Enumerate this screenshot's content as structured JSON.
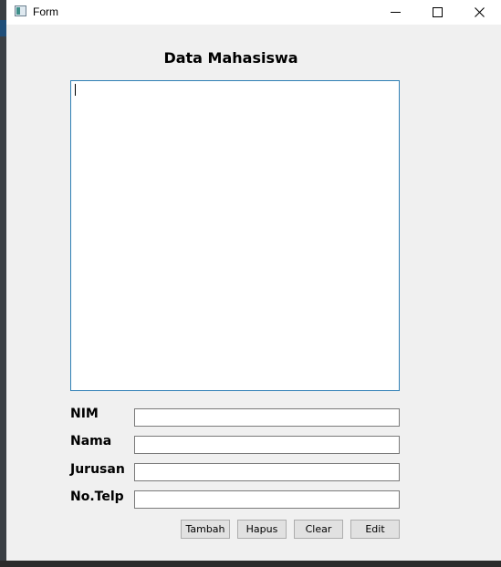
{
  "window": {
    "title": "Form",
    "controls": {
      "minimize_icon": "minimize-icon",
      "maximize_icon": "maximize-icon",
      "close_icon": "close-icon"
    }
  },
  "form": {
    "heading": "Data Mahasiswa",
    "output_text": "",
    "fields": [
      {
        "label": "NIM",
        "value": ""
      },
      {
        "label": "Nama",
        "value": ""
      },
      {
        "label": "Jurusan",
        "value": ""
      },
      {
        "label": "No.Telp",
        "value": ""
      }
    ],
    "buttons": {
      "tambah": "Tambah",
      "hapus": "Hapus",
      "clear": "Clear",
      "edit": "Edit"
    }
  },
  "colors": {
    "window_bg": "#f0f0f0",
    "focus_border": "#2f7fb5",
    "button_bg": "#e1e1e1"
  }
}
